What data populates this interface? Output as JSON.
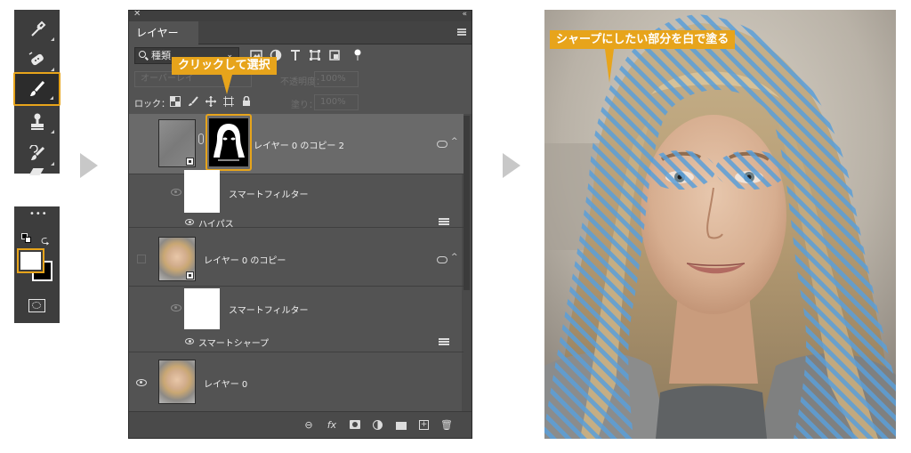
{
  "panel": {
    "tab_label": "レイヤー",
    "kind_select": "種類",
    "blend_mode": "オーバーレイ",
    "opacity_label": "不透明度：",
    "opacity_value": "100%",
    "lock_label": "ロック：",
    "fill_label": "塗り：",
    "fill_value": "100%",
    "layers": [
      {
        "name": "レイヤー 0 のコピー 2",
        "selected": true
      },
      {
        "name": "スマートフィルター",
        "type": "smart-filter"
      },
      {
        "name": "ハイパス",
        "type": "filter"
      },
      {
        "name": "レイヤー 0 のコピー",
        "selected": false
      },
      {
        "name": "スマートフィルター",
        "type": "smart-filter"
      },
      {
        "name": "スマートシャープ",
        "type": "filter"
      },
      {
        "name": "レイヤー 0",
        "selected": false
      }
    ],
    "bottom_icons": [
      "link-icon",
      "fx-icon",
      "mask-icon",
      "adjustment-icon",
      "group-folder-icon",
      "new-layer-icon",
      "trash-icon"
    ],
    "fx_label": "fx"
  },
  "callouts": {
    "click_select": "クリックして選択",
    "paint_white": "シャープにしたい部分を白で塗る"
  },
  "colors": {
    "accent": "#e7a41b",
    "panel_bg": "#535353",
    "toolbar_bg": "#3d3d3d",
    "hatch": "#5b9fd8"
  },
  "toolbar": {
    "tools": [
      "eyedropper-icon",
      "healing-brush-icon",
      "brush-icon",
      "clone-stamp-icon",
      "history-brush-icon",
      "eraser-icon"
    ],
    "selected_tool": "brush-icon",
    "bottom_tools": [
      "more-icon",
      "default-colors-icon",
      "swap-colors-icon",
      "foreground-background-swatch",
      "quick-mask-icon"
    ]
  }
}
